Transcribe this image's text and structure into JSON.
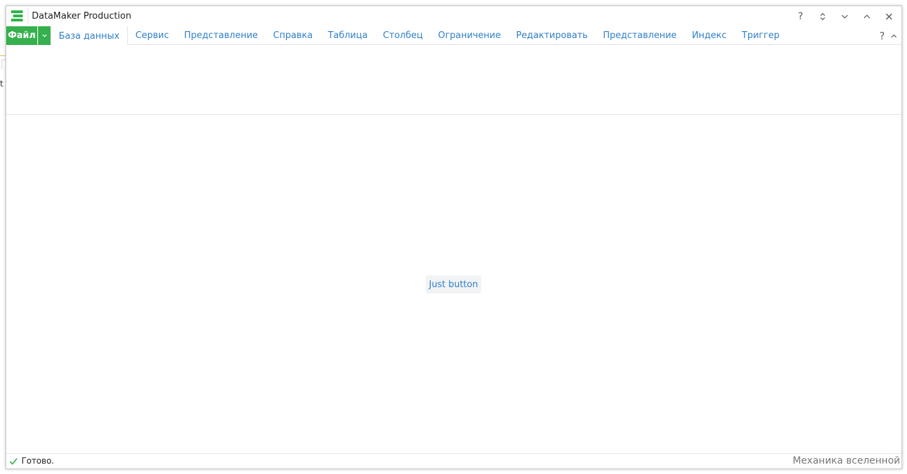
{
  "window": {
    "title": "DataMaker Production",
    "controls": {
      "help": "?",
      "restore": "",
      "minimize": "",
      "maximize": "",
      "close": ""
    }
  },
  "ribbon": {
    "file_label": "Файл",
    "tabs": [
      {
        "label": "База данных",
        "active": true
      },
      {
        "label": "Сервис",
        "active": false
      },
      {
        "label": "Представление",
        "active": false
      },
      {
        "label": "Справка",
        "active": false
      },
      {
        "label": "Таблица",
        "active": false
      },
      {
        "label": "Столбец",
        "active": false
      },
      {
        "label": "Ограничение",
        "active": false
      },
      {
        "label": "Редактировать",
        "active": false
      },
      {
        "label": "Представление",
        "active": false
      },
      {
        "label": "Индекс",
        "active": false
      },
      {
        "label": "Триггер",
        "active": false
      }
    ],
    "help": "?"
  },
  "content": {
    "button_label": "Just button"
  },
  "status": {
    "text": "Готово.",
    "right_text": "Механика вселенной"
  },
  "background": {
    "edge_text": "t"
  },
  "colors": {
    "accent_green": "#35b04d",
    "link_blue": "#2f7fc8"
  },
  "icons": {
    "app": "app-logo-icon",
    "status": "check-icon"
  }
}
